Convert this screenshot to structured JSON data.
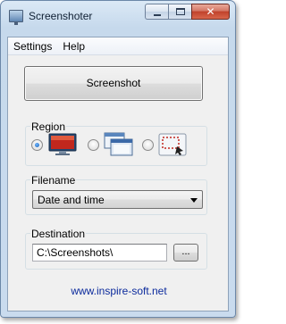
{
  "window": {
    "title": "Screenshoter"
  },
  "titlebar_buttons": {
    "minimize": "minimize",
    "maximize": "maximize",
    "close": "✕"
  },
  "menu": [
    "Settings",
    "Help"
  ],
  "screenshot_button": "Screenshot",
  "region": {
    "label": "Region",
    "options": [
      {
        "icon": "full-screen-icon",
        "selected": true
      },
      {
        "icon": "window-capture-icon",
        "selected": false
      },
      {
        "icon": "selection-capture-icon",
        "selected": false
      }
    ]
  },
  "filename": {
    "label": "Filename",
    "selected": "Date and time"
  },
  "destination": {
    "label": "Destination",
    "value": "C:\\Screenshots\\",
    "browse_label": "..."
  },
  "link": "www.inspire-soft.net",
  "colors": {
    "link": "#0b2a9c",
    "frame": "#c6d9ec",
    "close_button": "#c0412b"
  }
}
